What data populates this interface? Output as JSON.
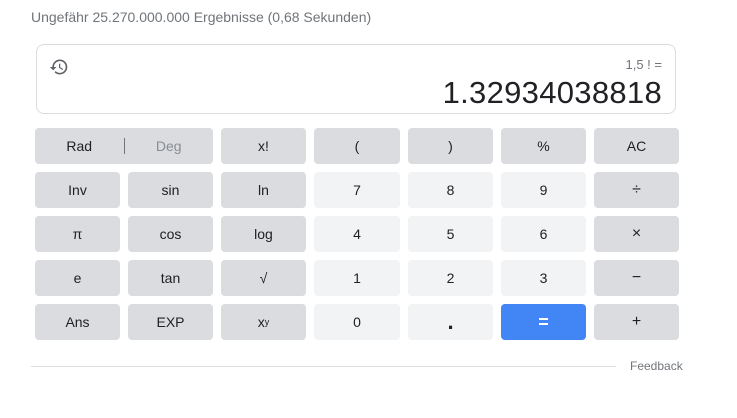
{
  "results_stats": "Ungefähr 25.270.000.000 Ergebnisse (0,68 Sekunden)",
  "display": {
    "expression": "1,5 ! =",
    "result": "1.32934038818",
    "history_icon": "history-icon"
  },
  "keys": {
    "rad": "Rad",
    "deg": "Deg",
    "factorial": "x!",
    "paren_open": "(",
    "paren_close": ")",
    "percent": "%",
    "ac": "AC",
    "inv": "Inv",
    "sin": "sin",
    "ln": "ln",
    "seven": "7",
    "eight": "8",
    "nine": "9",
    "divide": "÷",
    "pi": "π",
    "cos": "cos",
    "log": "log",
    "four": "4",
    "five": "5",
    "six": "6",
    "multiply": "×",
    "e": "e",
    "tan": "tan",
    "sqrt": "√",
    "one": "1",
    "two": "2",
    "three": "3",
    "minus": "−",
    "ans": "Ans",
    "exp": "EXP",
    "power_base": "x",
    "power_exp": "y",
    "zero": "0",
    "dot": ".",
    "equals": "=",
    "plus": "+"
  },
  "feedback": "Feedback",
  "colors": {
    "func_key": "#dadce0",
    "num_key": "#f1f3f4",
    "equals_key": "#4285f4"
  }
}
